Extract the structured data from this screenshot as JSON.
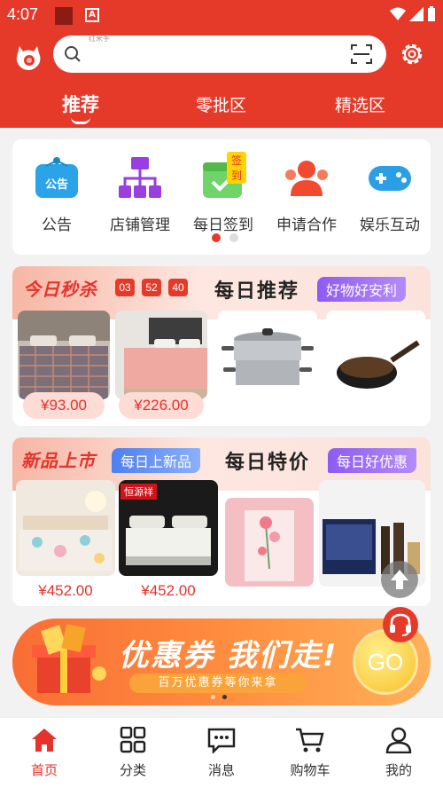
{
  "status_bar": {
    "time": "4:07",
    "notif_badge": "A"
  },
  "header": {
    "search_hint": "红米手",
    "tabs": [
      {
        "label": "推荐",
        "active": true
      },
      {
        "label": "零批区",
        "active": false
      },
      {
        "label": "精选区",
        "active": false
      }
    ]
  },
  "quick_menu": {
    "items": [
      {
        "label": "公告",
        "icon": "announcement-icon",
        "icon_text": "公告"
      },
      {
        "label": "店铺管理",
        "icon": "store-management-icon"
      },
      {
        "label": "每日签到",
        "icon": "daily-checkin-icon",
        "tag": "签到"
      },
      {
        "label": "申请合作",
        "icon": "cooperation-icon"
      },
      {
        "label": "娱乐互动",
        "icon": "gamepad-icon"
      }
    ],
    "page_dots": 2,
    "active_page": 1
  },
  "flash_sale": {
    "title": "今日秒杀",
    "timer": [
      "03",
      "52",
      "40"
    ],
    "rec_title": "每日推荐",
    "rec_badge": "好物好安利",
    "products": [
      {
        "name": "quilt-grey",
        "price": "¥93.00"
      },
      {
        "name": "quilt-pink",
        "price": "¥226.00"
      },
      {
        "name": "steamer-pot"
      },
      {
        "name": "black-wok"
      }
    ]
  },
  "new_arrivals": {
    "title": "新品上市",
    "badge": "每日上新品",
    "special_title": "每日特价",
    "special_badge": "每日好优惠",
    "products": [
      {
        "name": "floral-quilt",
        "price": "¥452.00"
      },
      {
        "name": "mattress",
        "price": "¥452.00",
        "tag": "恒源祥"
      },
      {
        "name": "roses-box"
      },
      {
        "name": "cosmetics-set"
      }
    ]
  },
  "banner": {
    "title": "优惠券 我们走!",
    "subtitle": "百万优惠券等你来拿",
    "go_label": "GO"
  },
  "bottom_nav": {
    "items": [
      {
        "label": "首页",
        "icon": "home-icon",
        "active": true
      },
      {
        "label": "分类",
        "icon": "category-icon",
        "active": false
      },
      {
        "label": "消息",
        "icon": "message-icon",
        "active": false
      },
      {
        "label": "购物车",
        "icon": "cart-icon",
        "active": false
      },
      {
        "label": "我的",
        "icon": "profile-icon",
        "active": false
      }
    ]
  },
  "colors": {
    "brand": "#e53a2a",
    "price": "#e5322a",
    "purple_badge": "#8e5bf2",
    "blue_badge": "#4e7ff2"
  }
}
